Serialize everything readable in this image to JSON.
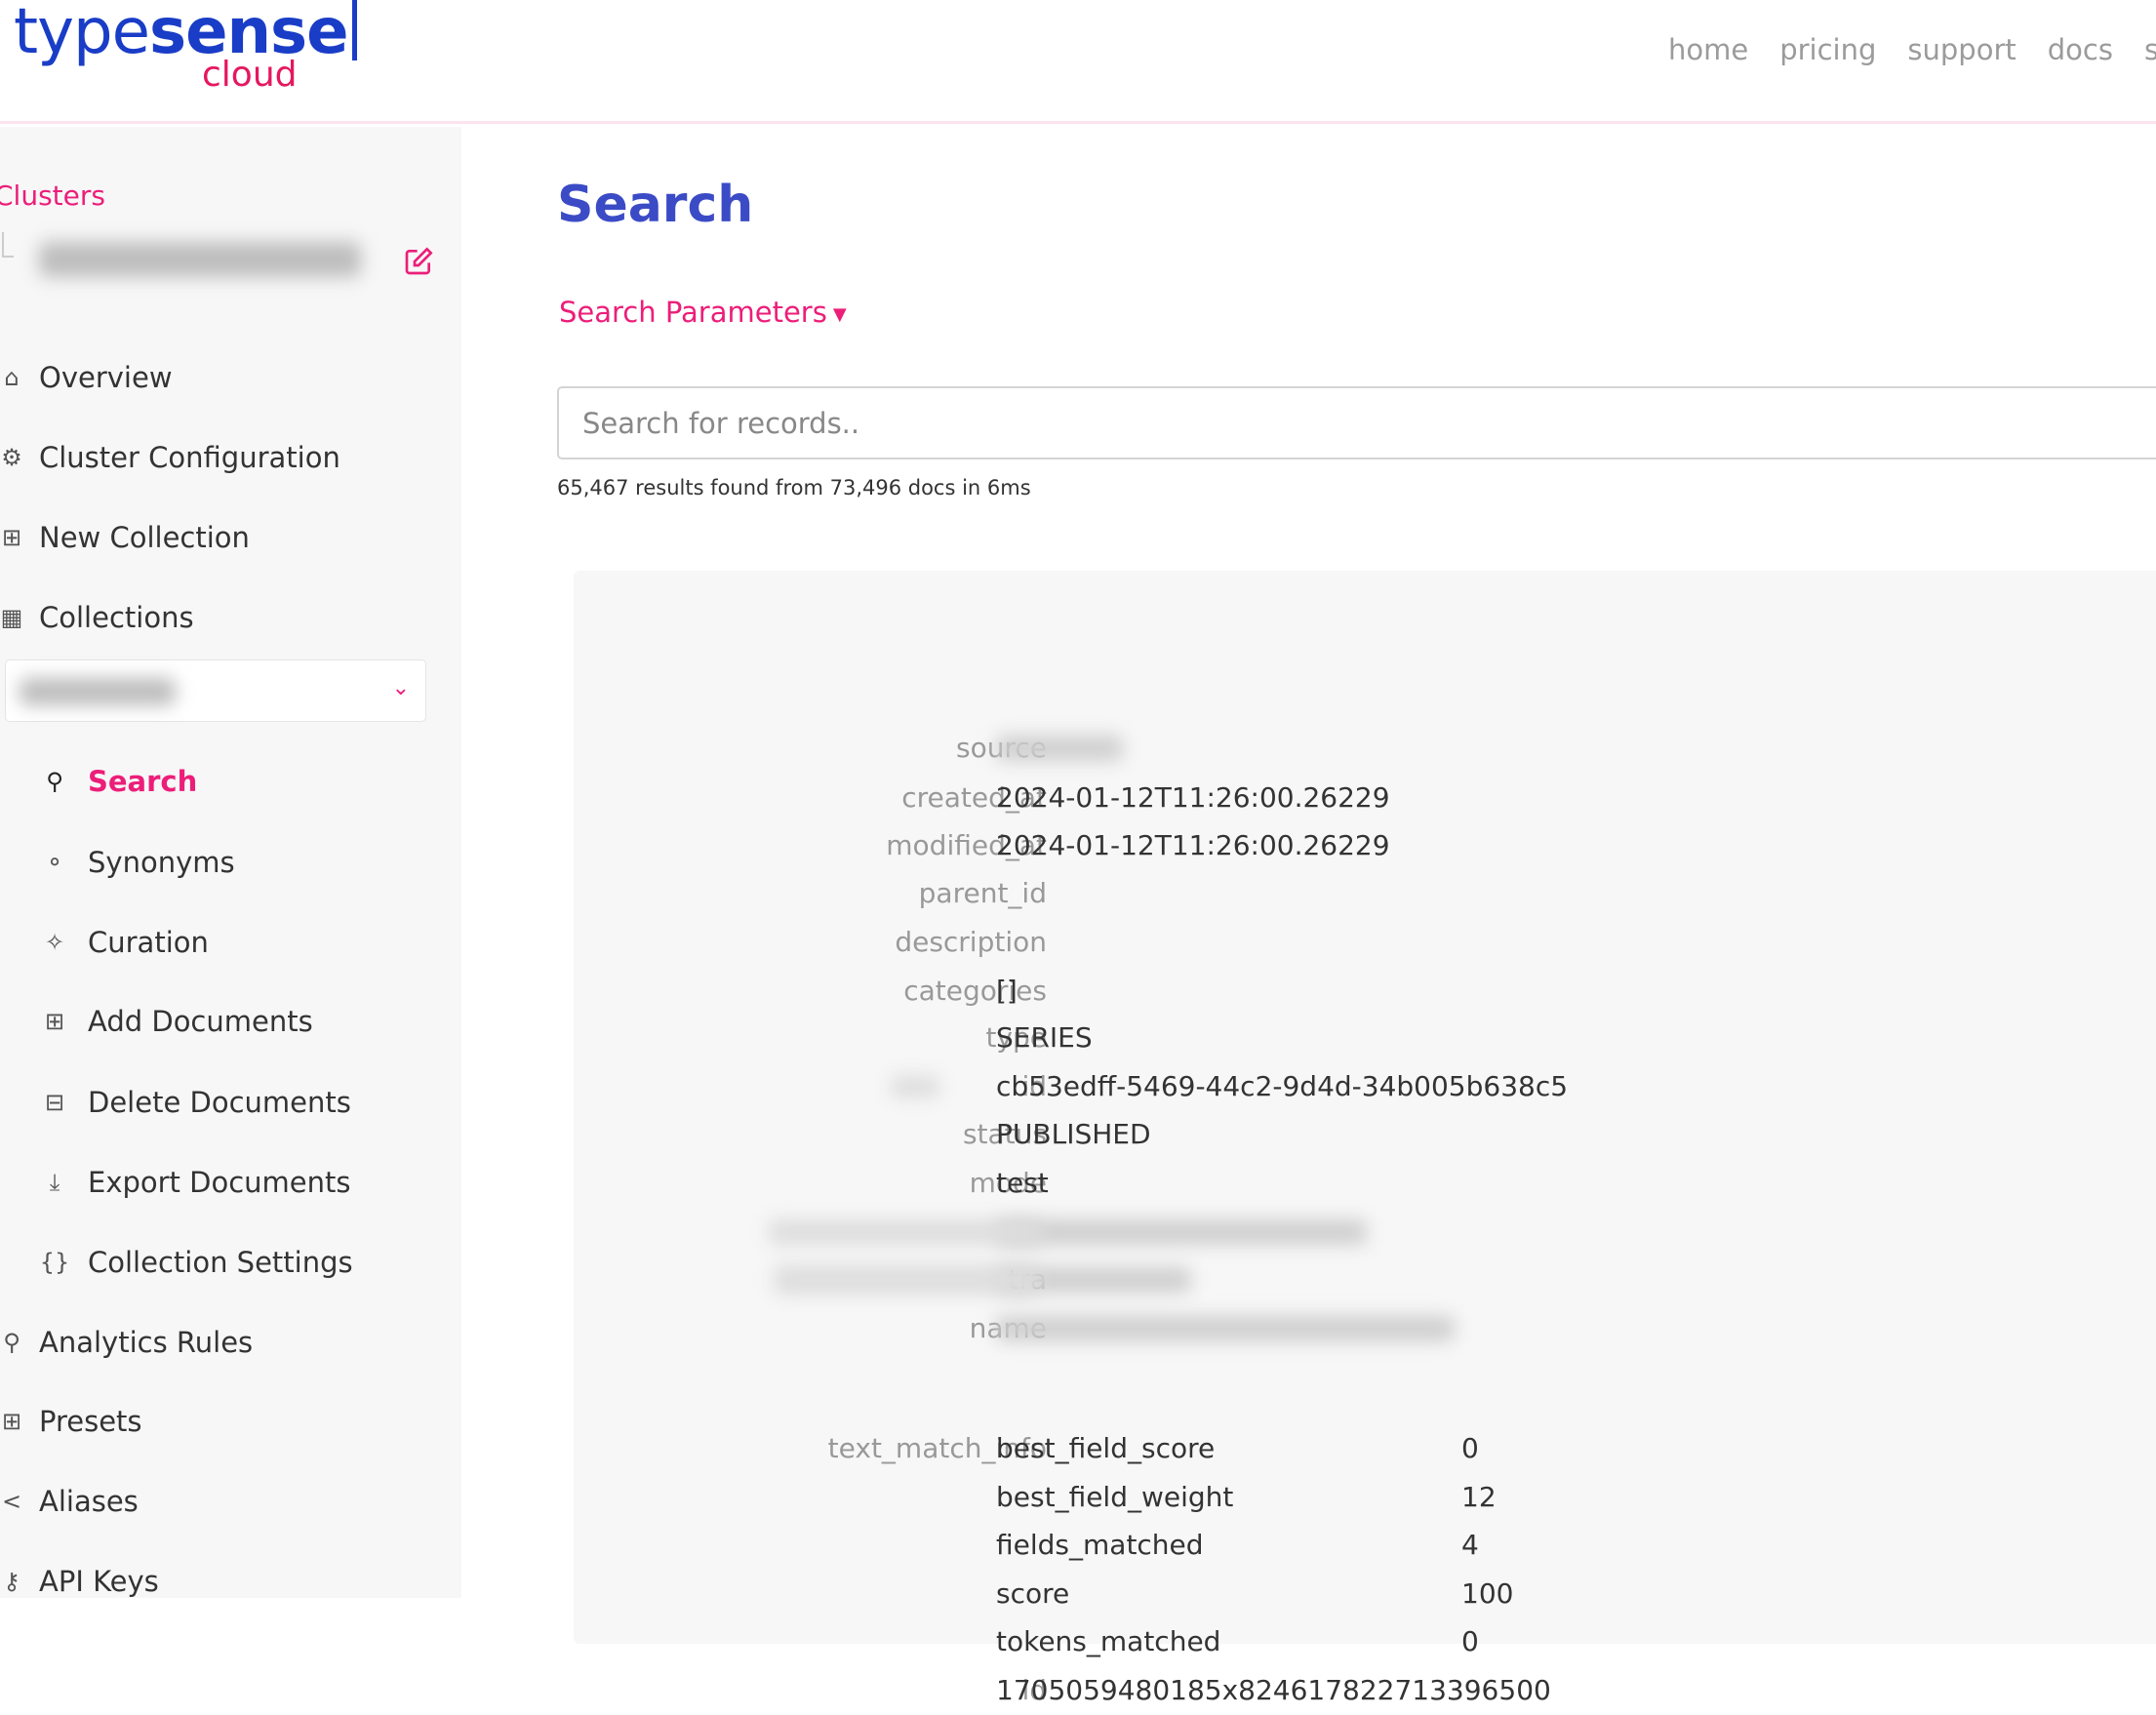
{
  "header": {
    "logo_type": "type",
    "logo_sense": "sense",
    "logo_cloud": "cloud",
    "nav": [
      "home",
      "pricing",
      "support",
      "docs",
      "stat"
    ]
  },
  "sidebar": {
    "clusters_label": "Clusters",
    "top_items": [
      {
        "label": "Overview",
        "icon": "home-icon"
      },
      {
        "label": "Cluster Configuration",
        "icon": "gear-icon"
      },
      {
        "label": "New Collection",
        "icon": "new-collection-icon"
      },
      {
        "label": "Collections",
        "icon": "grid-icon"
      }
    ],
    "sub_items": [
      {
        "label": "Search",
        "icon": "search-icon",
        "active": true
      },
      {
        "label": "Synonyms",
        "icon": "synonyms-icon"
      },
      {
        "label": "Curation",
        "icon": "magic-wand-icon"
      },
      {
        "label": "Add Documents",
        "icon": "add-documents-icon"
      },
      {
        "label": "Delete Documents",
        "icon": "delete-documents-icon"
      },
      {
        "label": "Export Documents",
        "icon": "download-icon"
      },
      {
        "label": "Collection Settings",
        "icon": "braces-icon"
      }
    ],
    "bottom_items": [
      {
        "label": "Analytics Rules",
        "icon": "analytics-icon"
      },
      {
        "label": "Presets",
        "icon": "table-icon"
      },
      {
        "label": "Aliases",
        "icon": "share-icon"
      },
      {
        "label": "API Keys",
        "icon": "key-icon"
      }
    ],
    "accent": "#ec1e79"
  },
  "main": {
    "title": "Search",
    "params_label": "Search Parameters",
    "search_placeholder": "Search for records..",
    "result_count": "65,467 results found from 73,496 docs in 6ms",
    "fields": [
      {
        "key": "source",
        "value": ""
      },
      {
        "key": "created_at",
        "value": "2024-01-12T11:26:00.26229"
      },
      {
        "key": "modified_at",
        "value": "2024-01-12T11:26:00.26229"
      },
      {
        "key": "parent_id",
        "value": ""
      },
      {
        "key": "description",
        "value": ""
      },
      {
        "key": "categories",
        "value": "[]"
      },
      {
        "key": "type",
        "value": "SERIES"
      },
      {
        "key": "id",
        "value": "cb53edff-5469-44c2-9d4d-34b005b638c5"
      },
      {
        "key": "status",
        "value": "PUBLISHED"
      },
      {
        "key": "mode",
        "value": "test"
      },
      {
        "key": "",
        "value": ""
      },
      {
        "key": "tra",
        "value": ""
      },
      {
        "key": "name",
        "value": ""
      }
    ],
    "text_match_info": {
      "key": "text_match_info",
      "items": [
        {
          "k": "best_field_score",
          "v": "0"
        },
        {
          "k": "best_field_weight",
          "v": "12"
        },
        {
          "k": "fields_matched",
          "v": "4"
        },
        {
          "k": "score",
          "v": "100"
        },
        {
          "k": "tokens_matched",
          "v": "0"
        }
      ]
    },
    "doc_id": {
      "key": "id",
      "value": "1705059480185x824617822713396500"
    }
  }
}
